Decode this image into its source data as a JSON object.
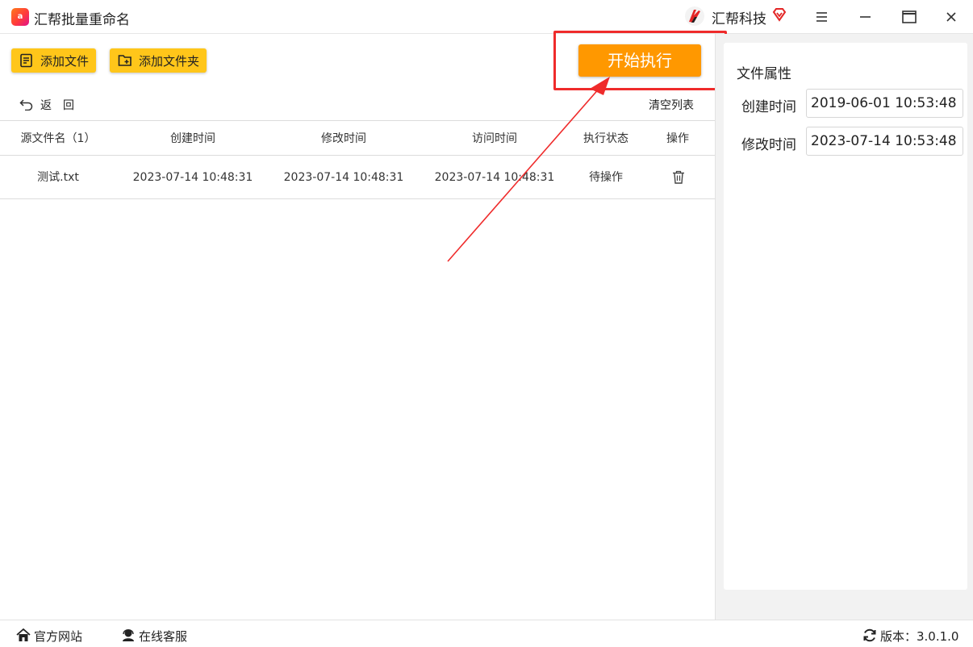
{
  "app": {
    "title": "汇帮批量重命名",
    "logo_text": "a"
  },
  "header": {
    "brand_name": "汇帮科技"
  },
  "toolbar": {
    "add_file_label": "添加文件",
    "add_folder_label": "添加文件夹",
    "start_label": "开始执行",
    "back_label": "返回",
    "clear_label": "清空列表"
  },
  "table": {
    "columns": [
      "源文件名（1）",
      "创建时间",
      "修改时间",
      "访问时间",
      "执行状态",
      "操作"
    ],
    "rows": [
      {
        "name": "测试.txt",
        "created": "2023-07-14 10:48:31",
        "modified": "2023-07-14 10:48:31",
        "accessed": "2023-07-14 10:48:31",
        "status": "待操作"
      }
    ]
  },
  "properties": {
    "title": "文件属性",
    "created_label": "创建时间",
    "created_value": "2019-06-01 10:53:48",
    "modified_label": "修改时间",
    "modified_value": "2023-07-14 10:53:48"
  },
  "statusbar": {
    "site_label": "官方网站",
    "service_label": "在线客服",
    "version_label": "版本：3.0.1.0"
  },
  "colors": {
    "tool_button": "#ffc61a",
    "start_button": "#ff9800",
    "annotation": "#ef2b2b"
  },
  "icons": [
    "app-logo-icon",
    "brand-logo-icon",
    "vip-diamond-icon",
    "menu-icon",
    "minimize-icon",
    "maximize-icon",
    "close-icon",
    "file-list-icon",
    "folder-add-icon",
    "back-arrow-icon",
    "trash-icon",
    "home-icon",
    "headset-icon",
    "refresh-icon"
  ]
}
